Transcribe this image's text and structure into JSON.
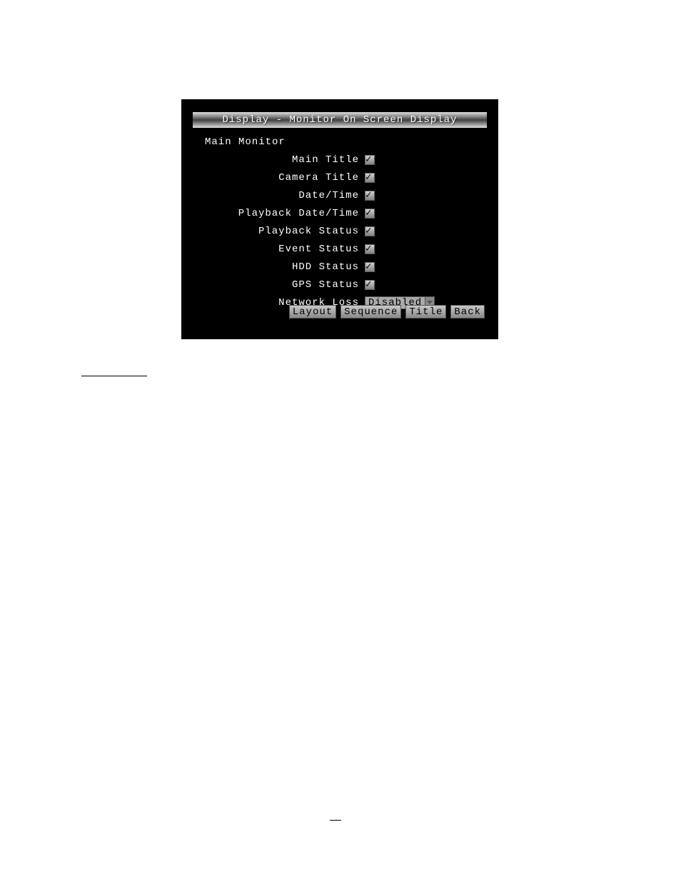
{
  "panel": {
    "title": "Display - Monitor On Screen Display",
    "section": "Main Monitor",
    "settings": [
      {
        "label": "Main Title",
        "type": "checkbox",
        "checked": true,
        "name": "main-title"
      },
      {
        "label": "Camera Title",
        "type": "checkbox",
        "checked": true,
        "name": "camera-title"
      },
      {
        "label": "Date/Time",
        "type": "checkbox",
        "checked": true,
        "name": "date-time"
      },
      {
        "label": "Playback Date/Time",
        "type": "checkbox",
        "checked": true,
        "name": "playback-date-time"
      },
      {
        "label": "Playback Status",
        "type": "checkbox",
        "checked": true,
        "name": "playback-status"
      },
      {
        "label": "Event Status",
        "type": "checkbox",
        "checked": true,
        "name": "event-status"
      },
      {
        "label": "HDD Status",
        "type": "checkbox",
        "checked": true,
        "name": "hdd-status"
      },
      {
        "label": "GPS Status",
        "type": "checkbox",
        "checked": true,
        "name": "gps-status"
      },
      {
        "label": "Network Loss",
        "type": "dropdown",
        "value": "Disabled",
        "name": "network-loss"
      }
    ],
    "buttons": {
      "layout": "Layout",
      "sequence": "Sequence",
      "title": "Title",
      "back": "Back"
    }
  }
}
